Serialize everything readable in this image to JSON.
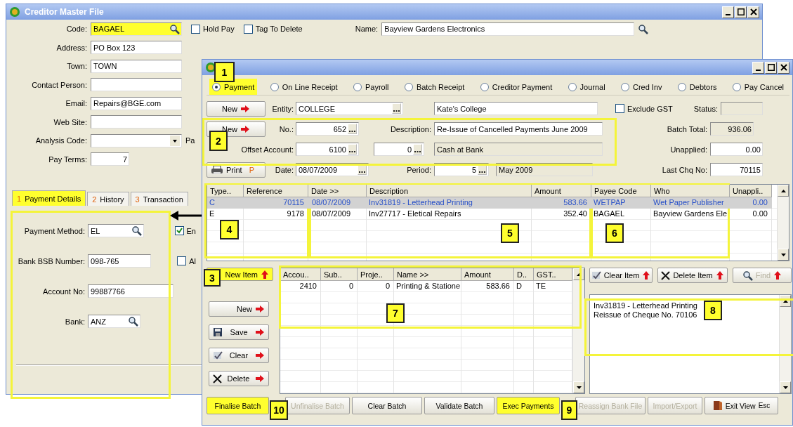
{
  "creditor_window": {
    "title": "Creditor Master File",
    "fields": [
      {
        "label": "Code:",
        "value": "BAGAEL",
        "kind": "lookup",
        "highlighted": true
      },
      {
        "label": "Address:",
        "value": "PO Box 123",
        "kind": "text",
        "highlighted": false
      },
      {
        "label": "Town:",
        "value": "TOWN",
        "kind": "text",
        "highlighted": false
      },
      {
        "label": "Contact Person:",
        "kind": "text",
        "highlighted": false
      },
      {
        "label": "Email:",
        "value": "Repairs@BGE.com",
        "kind": "text",
        "highlighted": false
      },
      {
        "label": "Web Site:",
        "kind": "text",
        "highlighted": false
      },
      {
        "label": "Analysis Code:",
        "kind": "dropdown",
        "highlighted": false,
        "side_label": "Pa"
      },
      {
        "label": "Pay Terms:",
        "value": "7",
        "kind": "number",
        "highlighted": false
      }
    ],
    "checkboxes": [
      {
        "label": "Hold Pay",
        "checked": false
      },
      {
        "label": "Tag To Delete",
        "checked": false
      }
    ],
    "name_field": {
      "label": "Name:",
      "value": "Bayview Gardens Electronics"
    },
    "tabs": [
      {
        "number": "1",
        "label": "Payment Details",
        "selected": true
      },
      {
        "number": "2",
        "label": "History",
        "selected": false
      },
      {
        "number": "3",
        "label": "Transaction",
        "selected": false
      }
    ],
    "payment_fields": [
      {
        "label": "Payment Method:",
        "value": "EL",
        "kind": "lookup"
      },
      {
        "label": "Bank BSB Number:",
        "value": "098-765",
        "kind": "text"
      },
      {
        "label": "Account No:",
        "value": "99887766",
        "kind": "text"
      },
      {
        "label": "Bank:",
        "value": "ANZ",
        "kind": "lookup"
      }
    ],
    "side_checkboxes": [
      {
        "label": "En",
        "checked": true
      },
      {
        "label": "Al",
        "checked": false
      }
    ]
  },
  "batch_window": {
    "transaction_types": [
      {
        "label": "Payment",
        "selected": true,
        "highlighted": true
      },
      {
        "label": "On Line Receipt",
        "selected": false,
        "highlighted": false
      },
      {
        "label": "Payroll",
        "selected": false,
        "highlighted": false
      },
      {
        "label": "Batch Receipt",
        "selected": false,
        "highlighted": false
      },
      {
        "label": "Creditor Payment",
        "selected": false,
        "highlighted": false
      },
      {
        "label": "Journal",
        "selected": false,
        "highlighted": false
      },
      {
        "label": "Cred Inv",
        "selected": false,
        "highlighted": false
      },
      {
        "label": "Debtors",
        "selected": false,
        "highlighted": false
      },
      {
        "label": "Pay Cancel",
        "selected": false,
        "highlighted": false
      }
    ],
    "entity": {
      "button": "New",
      "label": "Entity:",
      "code": "COLLEGE",
      "name": "Kate's College"
    },
    "exclude_gst": {
      "label": "Exclude GST",
      "checked": false
    },
    "status": {
      "label": "Status:",
      "readonly": true
    },
    "batch": {
      "button": "New",
      "no_label": "No.:",
      "no": "652",
      "description_label": "Description:",
      "description": "Re-Issue of Cancelled Payments June 2009",
      "offset_label": "Offset Account:",
      "offset_account": "6100",
      "offset_sub": "0",
      "offset_name": {
        "value": "Cash at Bank",
        "readonly": true
      }
    },
    "totals": [
      {
        "label": "Batch Total:",
        "value": "936.06",
        "readonly": true
      },
      {
        "label": "Unapplied:",
        "value": "0.00",
        "readonly": false
      },
      {
        "label": "Last Chq No:",
        "value": "70115",
        "readonly": false
      }
    ],
    "print_row": {
      "button": "Print",
      "shortcut": "P",
      "date_label": "Date:",
      "date": "08/07/2009",
      "period_label": "Period:",
      "period": "5",
      "period_name": {
        "value": "May 2009",
        "readonly": true
      }
    },
    "transactions": {
      "columns": [
        "Type..",
        "Reference",
        "Date >>",
        "Description",
        "Amount",
        "Payee Code",
        "Who",
        "Unappli.."
      ],
      "rows": [
        {
          "selected": true,
          "cells": [
            "C",
            "70115",
            "08/07/2009",
            "Inv31819 - Letterhead Printing",
            "583.66",
            "WETPAP",
            "Wet Paper Publisher",
            "0.00"
          ]
        },
        {
          "selected": false,
          "cells": [
            "E",
            "9178",
            "08/07/2009",
            "Inv27717 - Eletical Repairs",
            "352.40",
            "BAGAEL",
            "Bayview Gardens Ele",
            "0.00"
          ]
        }
      ]
    },
    "item_buttons": [
      {
        "label": "New Item",
        "kind": "new_item",
        "highlighted": true
      },
      {
        "label": "New",
        "kind": "new",
        "highlighted": false
      },
      {
        "label": "Save",
        "kind": "save",
        "highlighted": false
      },
      {
        "label": "Clear",
        "kind": "clear",
        "highlighted": false
      },
      {
        "label": "Delete",
        "kind": "delete",
        "highlighted": false
      }
    ],
    "items": {
      "columns": [
        "Accou..",
        "Sub..",
        "Proje..",
        "Name >>",
        "Amount",
        "D..",
        "GST.."
      ],
      "rows": [
        {
          "cells": [
            "2410",
            "0",
            "0",
            "Printing & Statione",
            "583.66",
            "D",
            "TE"
          ]
        }
      ]
    },
    "item_actions": [
      {
        "label": "Clear Item",
        "kind": "clear",
        "disabled": false
      },
      {
        "label": "Delete Item",
        "kind": "delete",
        "disabled": false
      },
      {
        "label": "Find",
        "kind": "find",
        "disabled": true
      }
    ],
    "memo": [
      "Inv31819 - Letterhead Printing",
      "Reissue of Cheque No. 70106"
    ],
    "batch_buttons": [
      {
        "label": "Finalise Batch",
        "highlighted": true,
        "disabled": false
      },
      {
        "label": "Unfinalise Batch",
        "highlighted": false,
        "disabled": true
      },
      {
        "label": "Clear Batch",
        "highlighted": false,
        "disabled": false
      },
      {
        "label": "Validate Batch",
        "highlighted": false,
        "disabled": false
      },
      {
        "label": "Exec Payments",
        "highlighted": true,
        "disabled": false
      },
      {
        "label": "Reassign Bank File",
        "highlighted": false,
        "disabled": true
      },
      {
        "label": "Import/Export",
        "highlighted": false,
        "disabled": true
      },
      {
        "label": "Exit View",
        "shortcut": "Esc",
        "highlighted": false,
        "disabled": false
      }
    ]
  },
  "callouts": [
    "1",
    "2",
    "3",
    "4",
    "5",
    "6",
    "7",
    "8",
    "9",
    "10"
  ]
}
